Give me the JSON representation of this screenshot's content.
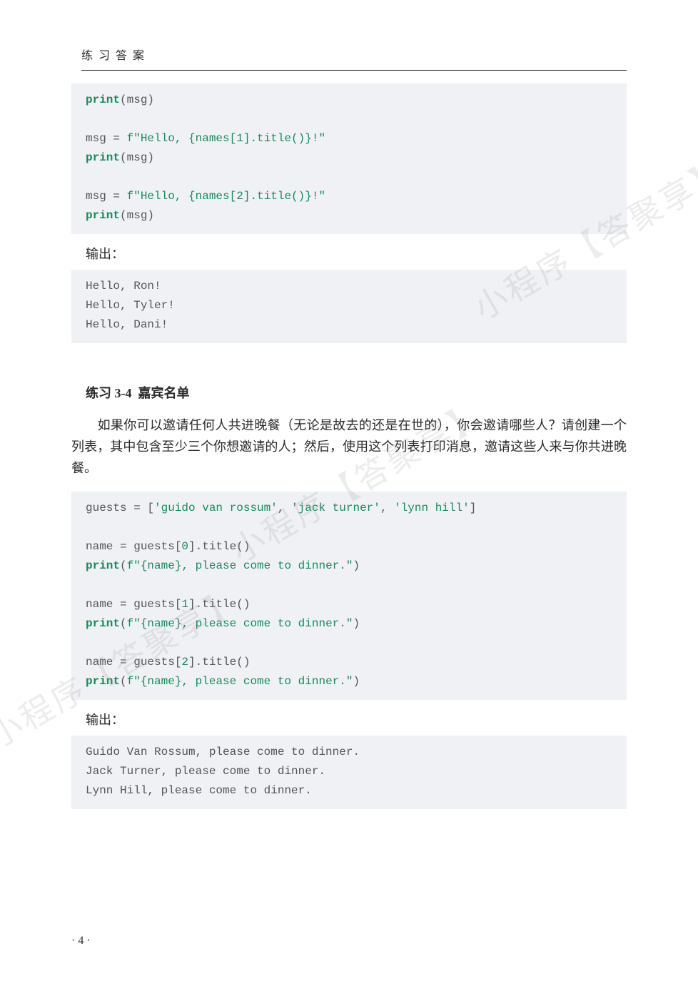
{
  "header": "练 习 答 案",
  "code1": {
    "l1a": "print",
    "l1b": "(msg)",
    "l2a": "msg = ",
    "l2b": "f\"Hello, {names[",
    "l2c": "1",
    "l2d": "].title()}!\"",
    "l3a": "print",
    "l3b": "(msg)",
    "l4a": "msg = ",
    "l4b": "f\"Hello, {names[",
    "l4c": "2",
    "l4d": "].title()}!\"",
    "l5a": "print",
    "l5b": "(msg)"
  },
  "output_label1": "输出：",
  "output1": "Hello, Ron!\nHello, Tyler!\nHello, Dani!",
  "section": {
    "num": "练习 3-4",
    "title": "嘉宾名单"
  },
  "body": "如果你可以邀请任何人共进晚餐（无论是故去的还是在世的），你会邀请哪些人？请创建一个列表，其中包含至少三个你想邀请的人；然后，使用这个列表打印消息，邀请这些人来与你共进晚餐。",
  "code2": {
    "l1a": "guests = [",
    "l1b": "'guido van rossum'",
    "l1c": ", ",
    "l1d": "'jack turner'",
    "l1e": ", ",
    "l1f": "'lynn hill'",
    "l1g": "]",
    "l2a": "name = guests[",
    "l2b": "0",
    "l2c": "].title()",
    "l3a": "print",
    "l3b": "(",
    "l3c": "f\"{name}, please come to dinner.\"",
    "l3d": ")",
    "l4a": "name = guests[",
    "l4b": "1",
    "l4c": "].title()",
    "l5a": "print",
    "l5b": "(",
    "l5c": "f\"{name}, please come to dinner.\"",
    "l5d": ")",
    "l6a": "name = guests[",
    "l6b": "2",
    "l6c": "].title()",
    "l7a": "print",
    "l7b": "(",
    "l7c": "f\"{name}, please come to dinner.\"",
    "l7d": ")"
  },
  "output_label2": "输出：",
  "output2": "Guido Van Rossum, please come to dinner.\nJack Turner, please come to dinner.\nLynn Hill, please come to dinner.",
  "page_number": "· 4 ·",
  "watermark": "小程序【答聚享】"
}
